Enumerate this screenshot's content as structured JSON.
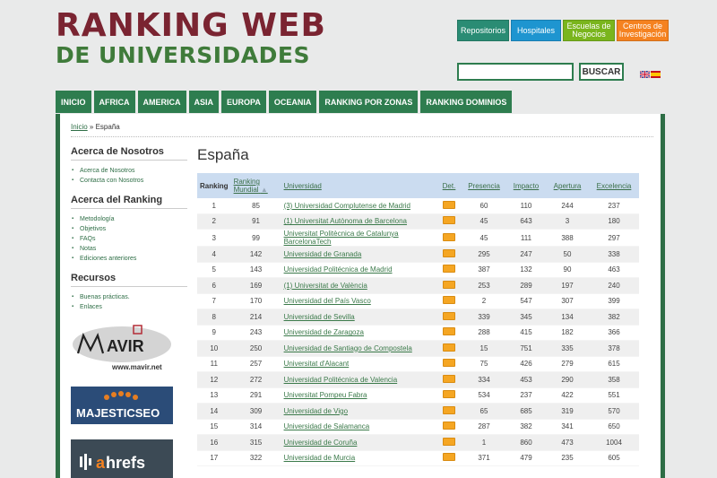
{
  "logo": {
    "line1": "RANKING WEB",
    "line2": "DE UNIVERSIDADES"
  },
  "top_tabs": [
    {
      "label": "Repositorios",
      "color": "#2a8c74"
    },
    {
      "label": "Hospitales",
      "color": "#1e95d0"
    },
    {
      "label": "Escuelas de Negocios",
      "color": "#7ab51d"
    },
    {
      "label": "Centros de Investigación",
      "color": "#f58220"
    }
  ],
  "search": {
    "button": "BUSCAR",
    "placeholder": ""
  },
  "nav": [
    "INICIO",
    "AFRICA",
    "AMERICA",
    "ASIA",
    "EUROPA",
    "OCEANIA",
    "RANKING POR ZONAS",
    "RANKING DOMINIOS"
  ],
  "breadcrumb": {
    "home": "Inicio",
    "sep": " » ",
    "current": "España"
  },
  "sidebar": {
    "about_title": "Acerca de Nosotros",
    "about_links": [
      "Acerca de Nosotros",
      "Contacta con Nosotros"
    ],
    "ranking_title": "Acerca del Ranking",
    "ranking_links": [
      "Metodología",
      "Objetivos",
      "FAQs",
      "Notas",
      "Ediciones anteriores"
    ],
    "resources_title": "Recursos",
    "resources_links": [
      "Buenas prácticas.",
      "Enlaces"
    ],
    "ads": {
      "mavir_url": "www.mavir.net",
      "majestic": "MAJESTICSEO",
      "ahrefs": "ahrefs"
    }
  },
  "main": {
    "title": "España",
    "headers": [
      "Ranking",
      "Ranking Mundial",
      "Universidad",
      "Det.",
      "Presencia",
      "Impacto",
      "Apertura",
      "Excelencia"
    ],
    "rows": [
      [
        "1",
        "85",
        "(3) Universidad Complutense de Madrid",
        "60",
        "110",
        "244",
        "237"
      ],
      [
        "2",
        "91",
        "(1) Universitat Autònoma de Barcelona",
        "45",
        "643",
        "3",
        "180"
      ],
      [
        "3",
        "99",
        "Universitat Politècnica de Catalunya BarcelonaTech",
        "45",
        "111",
        "388",
        "297"
      ],
      [
        "4",
        "142",
        "Universidad de Granada",
        "295",
        "247",
        "50",
        "338"
      ],
      [
        "5",
        "143",
        "Universidad Politécnica de Madrid",
        "387",
        "132",
        "90",
        "463"
      ],
      [
        "6",
        "169",
        "(1) Universitat de València",
        "253",
        "289",
        "197",
        "240"
      ],
      [
        "7",
        "170",
        "Universidad del País Vasco",
        "2",
        "547",
        "307",
        "399"
      ],
      [
        "8",
        "214",
        "Universidad de Sevilla",
        "339",
        "345",
        "134",
        "382"
      ],
      [
        "9",
        "243",
        "Universidad de Zaragoza",
        "288",
        "415",
        "182",
        "366"
      ],
      [
        "10",
        "250",
        "Universidad de Santiago de Compostela",
        "15",
        "751",
        "335",
        "378"
      ],
      [
        "11",
        "257",
        "Universitat d'Alacant",
        "75",
        "426",
        "279",
        "615"
      ],
      [
        "12",
        "272",
        "Universidad Politécnica de Valencia",
        "334",
        "453",
        "290",
        "358"
      ],
      [
        "13",
        "291",
        "Universitat Pompeu Fabra",
        "534",
        "237",
        "422",
        "551"
      ],
      [
        "14",
        "309",
        "Universidad de Vigo",
        "65",
        "685",
        "319",
        "570"
      ],
      [
        "15",
        "314",
        "Universidad de Salamanca",
        "287",
        "382",
        "341",
        "650"
      ],
      [
        "16",
        "315",
        "Universidad de Coruña",
        "1",
        "860",
        "473",
        "1004"
      ],
      [
        "17",
        "322",
        "Universidad de Murcia",
        "371",
        "479",
        "235",
        "605"
      ]
    ]
  }
}
